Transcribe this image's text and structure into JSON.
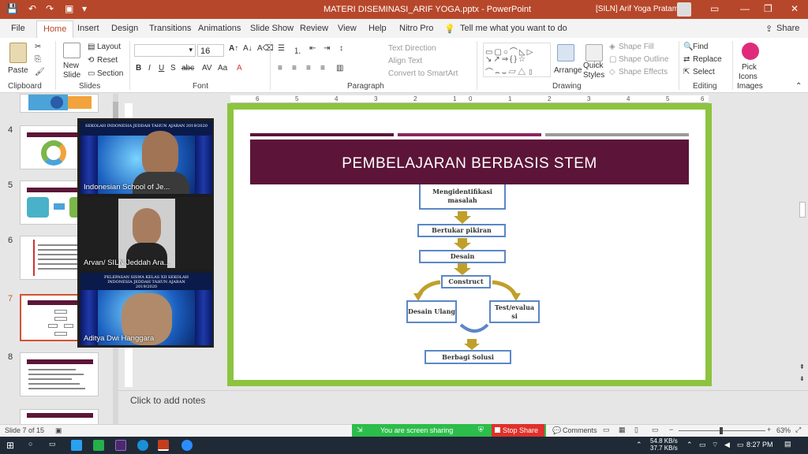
{
  "window": {
    "doc_title": "MATERI DISEMINASI_ARIF YOGA.pptx  -  PowerPoint",
    "user": "[SILN] Arif Yoga Pratama"
  },
  "tabs": [
    "File",
    "Home",
    "Insert",
    "Design",
    "Transitions",
    "Animations",
    "Slide Show",
    "Review",
    "View",
    "Help",
    "Nitro Pro"
  ],
  "tell_me": "Tell me what you want to do",
  "share_label": "Share",
  "ribbon": {
    "clipboard": {
      "paste": "Paste",
      "group": "Clipboard"
    },
    "slides": {
      "new_slide": "New",
      "new_slide2": "Slide",
      "layout": "Layout",
      "reset": "Reset",
      "section": "Section",
      "group": "Slides"
    },
    "font": {
      "size": "16",
      "group": "Font"
    },
    "paragraph": {
      "text_direction": "Text Direction",
      "align_text": "Align Text",
      "smartart": "Convert to SmartArt",
      "group": "Paragraph"
    },
    "drawing": {
      "arrange": "Arrange",
      "quick": "Quick",
      "styles": "Styles",
      "fill": "Shape Fill",
      "outline": "Shape Outline",
      "effects": "Shape Effects",
      "group": "Drawing"
    },
    "editing": {
      "find": "Find",
      "replace": "Replace",
      "select": "Select",
      "group": "Editing"
    },
    "pick": {
      "l1": "Pick",
      "l2": "Icons",
      "l3": "Images"
    }
  },
  "thumbs": [
    "4",
    "5",
    "6",
    "7",
    "8"
  ],
  "slide": {
    "title": "PEMBELAJARAN BERBASIS STEM",
    "flow": {
      "step1": "Mengidentifikasi masalah",
      "step2": "Bertukar pikiran",
      "step3": "Desain",
      "step4": "Construct",
      "left": "Desain Ulang",
      "right": "Test/evalua si",
      "final": "Berbagi Solusi"
    }
  },
  "videos": [
    {
      "name": "Indonesian School of Je...",
      "banner": "SEKOLAH INDONESIA JEDDAH TAHUN AJARAN 2019/2020"
    },
    {
      "name": "Arvan/ SILN Jeddah Ara..."
    },
    {
      "name": "Aditya Dwi Hanggara",
      "banner": "PELEPASAN SISWA KELAS XII SEKOLAH INDONESIA JEDDAH TAHUN AJARAN 2019/2020"
    }
  ],
  "notes_placeholder": "Click to add notes",
  "status": {
    "slide": "Slide 7 of 15",
    "sharing": "You are screen sharing",
    "stop": "Stop Share",
    "comments": "Comments",
    "zoom": "63%"
  },
  "taskbar": {
    "net1": "54.8 KB/s",
    "net2": "37.7 KB/s",
    "time": "8:27 PM"
  },
  "colors": {
    "accent": "#b7472a",
    "slide_banner": "#5c1538",
    "frame": "#8cc43f",
    "arrow": "#c0a02a",
    "box_border": "#5b87c6"
  }
}
